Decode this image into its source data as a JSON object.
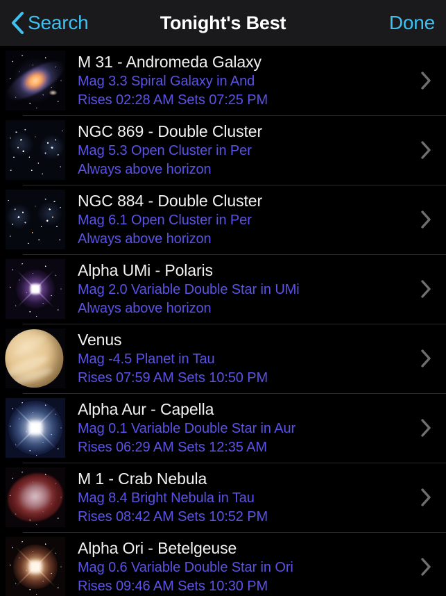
{
  "navbar": {
    "back_label": "Search",
    "back_icon": "chevron-left-icon",
    "title": "Tonight's Best",
    "done_label": "Done",
    "accent_color": "#3fc0f0",
    "background_color": "#1a1a1c"
  },
  "theme": {
    "page_background": "#000000",
    "title_color": "#f2f2f2",
    "subtitle_color": "#5b52e8",
    "separator_color": "#2b2b2d",
    "chevron_icon": "chevron-right-icon"
  },
  "list": {
    "items": [
      {
        "title": "M 31 - Andromeda Galaxy",
        "info": "Mag 3.3 Spiral Galaxy in And",
        "times": "Rises 02:28 AM  Sets 07:25 PM",
        "thumb": "andromeda-galaxy-thumbnail",
        "magnitude": "3.3",
        "object_type": "Spiral Galaxy",
        "constellation": "And"
      },
      {
        "title": "NGC 869 - Double Cluster",
        "info": "Mag 5.3 Open Cluster in Per",
        "times": "Always above horizon",
        "thumb": "open-cluster-thumbnail",
        "magnitude": "5.3",
        "object_type": "Open Cluster",
        "constellation": "Per"
      },
      {
        "title": "NGC 884 - Double Cluster",
        "info": "Mag 6.1 Open Cluster in Per",
        "times": "Always above horizon",
        "thumb": "open-cluster-thumbnail",
        "magnitude": "6.1",
        "object_type": "Open Cluster",
        "constellation": "Per"
      },
      {
        "title": "Alpha UMi - Polaris",
        "info": "Mag 2.0 Variable Double Star in UMi",
        "times": "Always above horizon",
        "thumb": "polaris-star-thumbnail",
        "magnitude": "2.0",
        "object_type": "Variable Double Star",
        "constellation": "UMi"
      },
      {
        "title": "Venus",
        "info": "Mag -4.5 Planet in Tau",
        "times": "Rises 07:59 AM  Sets 10:50 PM",
        "thumb": "venus-planet-thumbnail",
        "magnitude": "-4.5",
        "object_type": "Planet",
        "constellation": "Tau"
      },
      {
        "title": "Alpha Aur - Capella",
        "info": "Mag 0.1 Variable Double Star in Aur",
        "times": "Rises 06:29 AM  Sets 12:35 AM",
        "thumb": "capella-star-thumbnail",
        "magnitude": "0.1",
        "object_type": "Variable Double Star",
        "constellation": "Aur"
      },
      {
        "title": "M 1 - Crab Nebula",
        "info": "Mag 8.4 Bright Nebula in Tau",
        "times": "Rises 08:42 AM  Sets 10:52 PM",
        "thumb": "crab-nebula-thumbnail",
        "magnitude": "8.4",
        "object_type": "Bright Nebula",
        "constellation": "Tau"
      },
      {
        "title": "Alpha Ori - Betelgeuse",
        "info": "Mag 0.6 Variable Double Star in Ori",
        "times": "Rises 09:46 AM  Sets 10:30 PM",
        "thumb": "betelgeuse-star-thumbnail",
        "magnitude": "0.6",
        "object_type": "Variable Double Star",
        "constellation": "Ori"
      }
    ]
  }
}
